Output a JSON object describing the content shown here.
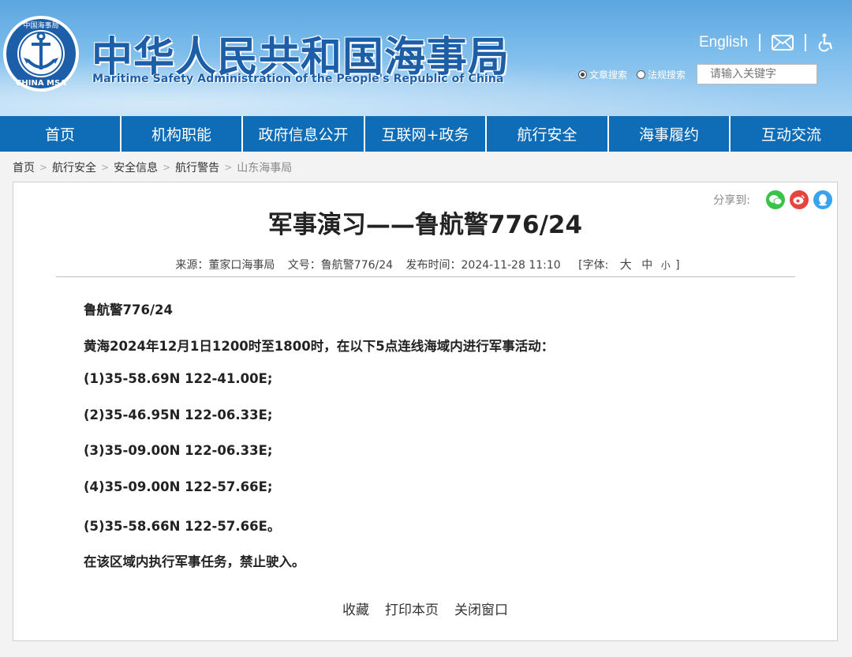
{
  "header": {
    "title_cn": "中华人民共和国海事局",
    "title_en": "Maritime Safety Administration of the People's Republic of China",
    "logo_text": "CHINA MSA",
    "logo_cn": "中国海事局",
    "english_link": "English",
    "search": {
      "options": [
        "文章搜索",
        "法规搜索"
      ],
      "selected": "文章搜索",
      "placeholder": "请输入关键字"
    }
  },
  "nav": {
    "items": [
      "首页",
      "机构职能",
      "政府信息公开",
      "互联网+政务",
      "航行安全",
      "海事履约",
      "互动交流"
    ]
  },
  "breadcrumb": [
    "首页",
    "航行安全",
    "安全信息",
    "航行警告",
    "山东海事局"
  ],
  "article": {
    "share_label": "分享到:",
    "title": "军事演习——鲁航警776/24",
    "meta": {
      "source": "来源：董家口海事局",
      "doc_no": "文号：鲁航警776/24",
      "published": "发布时间：2024-11-28 11:10",
      "font_label": "[字体:",
      "font_large": "大",
      "font_medium": "中",
      "font_small": "小",
      "font_close": "]"
    },
    "paragraphs": [
      "鲁航警776/24",
      "黄海2024年12月1日1200时至1800时，在以下5点连线海域内进行军事活动：",
      "(1)35-58.69N 122-41.00E;",
      "(2)35-46.95N 122-06.33E;",
      "(3)35-09.00N 122-06.33E;",
      "(4)35-09.00N 122-57.66E;",
      "(5)35-58.66N 122-57.66E。",
      "在该区域内执行军事任务，禁止驶入。"
    ],
    "actions": [
      "收藏",
      "打印本页",
      "关闭窗口"
    ]
  },
  "colors": {
    "nav_bg": "#0f6cb6",
    "title_blue": "#1d5ea8",
    "wechat": "#3bc24a",
    "weibo": "#e6453e",
    "qq": "#3aa3ee"
  },
  "icons": {
    "mail": "mail-icon",
    "accessibility": "accessibility-icon",
    "share": [
      "wechat-icon",
      "weibo-icon",
      "qq-icon"
    ]
  }
}
